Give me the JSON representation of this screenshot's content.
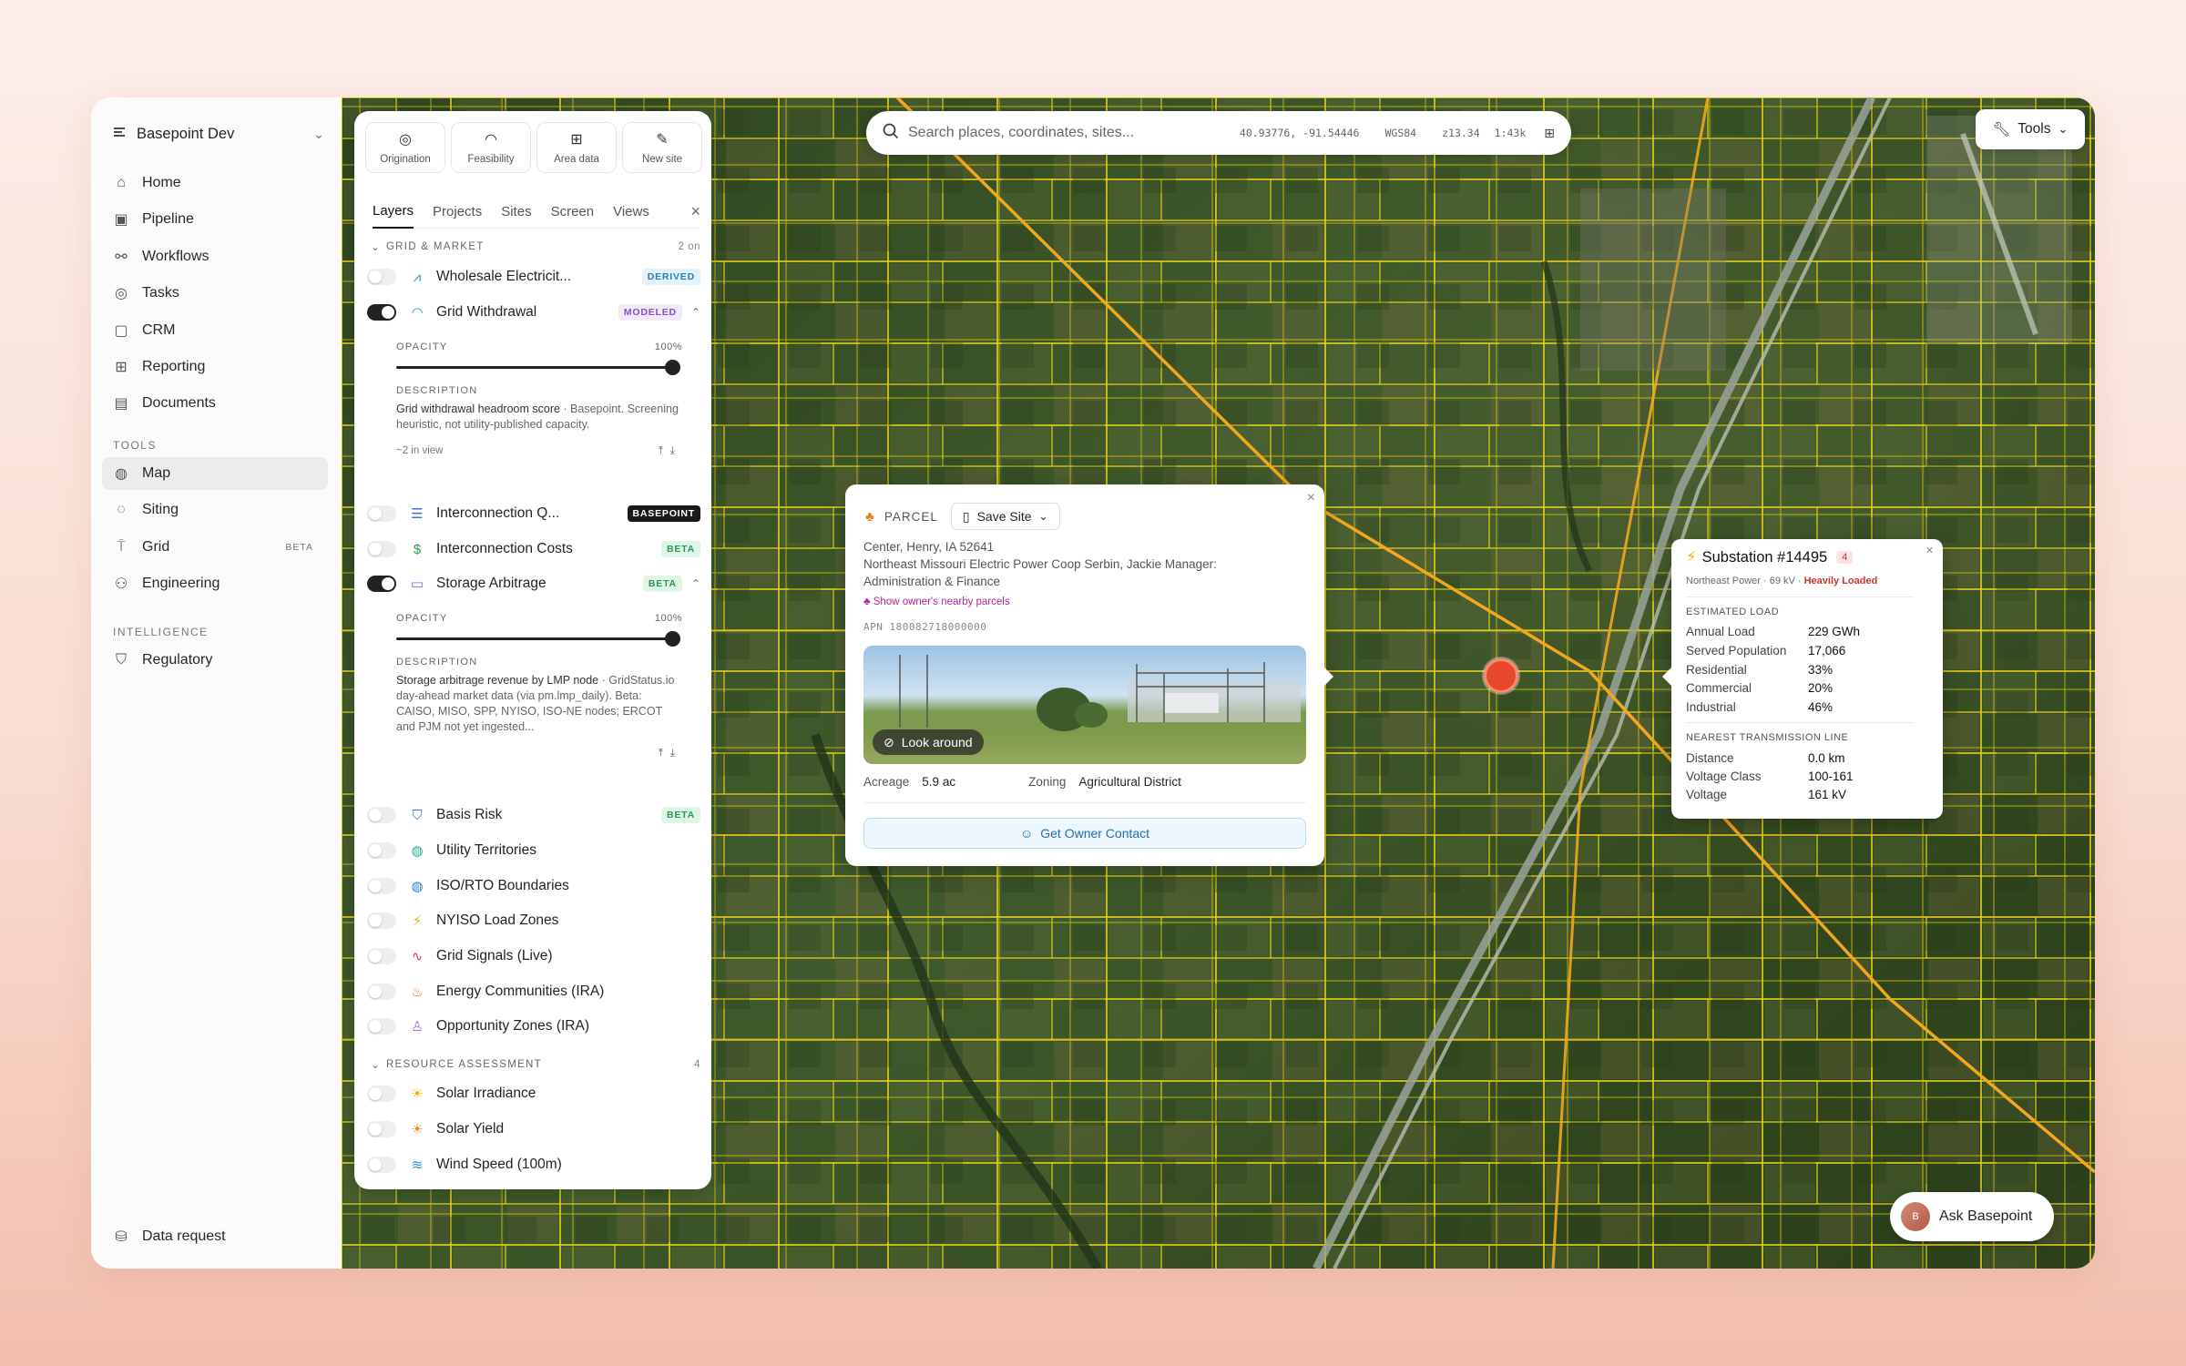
{
  "workspace": {
    "name": "Basepoint Dev"
  },
  "nav": {
    "main": [
      {
        "label": "Home",
        "icon": "home-icon"
      },
      {
        "label": "Pipeline",
        "icon": "briefcase-icon"
      },
      {
        "label": "Workflows",
        "icon": "workflow-icon"
      },
      {
        "label": "Tasks",
        "icon": "check-circle-icon"
      },
      {
        "label": "CRM",
        "icon": "contact-icon"
      },
      {
        "label": "Reporting",
        "icon": "grid-icon"
      },
      {
        "label": "Documents",
        "icon": "document-icon"
      }
    ],
    "tools_header": "TOOLS",
    "tools": [
      {
        "label": "Map",
        "icon": "globe-icon",
        "active": true
      },
      {
        "label": "Siting",
        "icon": "target-icon"
      },
      {
        "label": "Grid",
        "icon": "tower-icon",
        "badge": "BETA"
      },
      {
        "label": "Engineering",
        "icon": "engineer-icon"
      }
    ],
    "intelligence_header": "INTELLIGENCE",
    "intelligence": [
      {
        "label": "Regulatory",
        "icon": "shield-icon"
      }
    ],
    "bottom": {
      "label": "Data request",
      "icon": "database-icon"
    }
  },
  "panel": {
    "toolbar": [
      {
        "label": "Origination",
        "icon": "radar-icon"
      },
      {
        "label": "Feasibility",
        "icon": "gauge-icon"
      },
      {
        "label": "Area data",
        "icon": "table-icon"
      },
      {
        "label": "New site",
        "icon": "pencil-icon"
      }
    ],
    "tabs": [
      "Layers",
      "Projects",
      "Sites",
      "Screen",
      "Views"
    ],
    "grid_section": {
      "title": "GRID & MARKET",
      "count": "2 on"
    },
    "layers": [
      {
        "name": "Wholesale Electricit...",
        "tag": "DERIVED",
        "icon_color": "#2b8fd0",
        "icon": "pulse-icon"
      },
      {
        "name": "Grid Withdrawal",
        "tag": "MODELED",
        "icon_color": "#22a2a8",
        "icon": "gauge-icon",
        "on": true
      },
      {
        "name": "Interconnection Q...",
        "tag": "BASEPOINT",
        "icon_color": "#3d6fd6",
        "icon": "list-icon"
      },
      {
        "name": "Interconnection Costs",
        "tag": "BETA",
        "icon_color": "#2a9a55",
        "icon": "dollar-icon"
      },
      {
        "name": "Storage Arbitrage",
        "tag": "BETA",
        "icon_color": "#7c68d8",
        "icon": "battery-icon",
        "on": true
      },
      {
        "name": "Basis Risk",
        "tag": "BETA",
        "icon_color": "#3a78d0",
        "icon": "shield-icon"
      },
      {
        "name": "Utility Territories",
        "icon_color": "#1ea88e",
        "icon": "globe-icon"
      },
      {
        "name": "ISO/RTO Boundaries",
        "icon_color": "#2b7fd0",
        "icon": "globe-icon"
      },
      {
        "name": "NYISO Load Zones",
        "icon_color": "#f0b400",
        "icon": "bolt-icon"
      },
      {
        "name": "Grid Signals (Live)",
        "icon_color": "#e0345c",
        "icon": "signal-icon"
      },
      {
        "name": "Energy Communities (IRA)",
        "icon_color": "#e87b1e",
        "icon": "flame-icon"
      },
      {
        "name": "Opportunity Zones (IRA)",
        "icon_color": "#9b6dd8",
        "icon": "award-icon"
      }
    ],
    "grid_withdrawal_detail": {
      "opacity_label": "OPACITY",
      "opacity": "100%",
      "opacity_value": 1.0,
      "desc_label": "DESCRIPTION",
      "desc": "Grid withdrawal headroom score",
      "desc_src": " · Basepoint. Screening heuristic, not utility-published capacity.",
      "footer": "~2 in view"
    },
    "storage_detail": {
      "opacity_label": "OPACITY",
      "opacity": "100%",
      "opacity_value": 1.0,
      "desc_label": "DESCRIPTION",
      "desc": "Storage arbitrage revenue by LMP node",
      "desc_src": " · GridStatus.io day-ahead market data (via pm.lmp_daily). Beta: CAISO, MISO, SPP, NYISO, ISO-NE nodes; ERCOT and PJM not yet ingested..."
    },
    "resource_section": {
      "title": "RESOURCE ASSESSMENT",
      "count": "4"
    },
    "resource_layers": [
      {
        "name": "Solar Irradiance",
        "icon_color": "#f0b400",
        "icon": "sun-icon"
      },
      {
        "name": "Solar Yield",
        "icon_color": "#f08a1e",
        "icon": "sun-icon"
      },
      {
        "name": "Wind Speed (100m)",
        "icon_color": "#2b8fd0",
        "icon": "wind-icon"
      }
    ]
  },
  "search": {
    "placeholder": "Search places, coordinates, sites...",
    "coords": "40.93776, -91.54446",
    "datum": "WGS84",
    "zoom": "z13.34",
    "scale": "1:43k"
  },
  "tools_button": {
    "label": "Tools"
  },
  "parcel": {
    "type": "PARCEL",
    "save_label": "Save Site",
    "address": "Center, Henry, IA 52641",
    "owner": "Northeast Missouri Electric Power Coop Serbin, Jackie Manager: Administration & Finance",
    "owner_link": "Show owner's nearby parcels",
    "apn": "APN 180082718000000",
    "look_around": "Look around",
    "acreage_label": "Acreage",
    "acreage": "5.9 ac",
    "zoning_label": "Zoning",
    "zoning": "Agricultural District",
    "contact_label": "Get Owner Contact"
  },
  "substation": {
    "title": "Substation #14495",
    "count": "4",
    "operator": "Northeast Power · 69 kV · ",
    "status": "Heavily Loaded",
    "load_header": "ESTIMATED LOAD",
    "load_rows": [
      {
        "k": "Annual Load",
        "v": "229 GWh"
      },
      {
        "k": "Served Population",
        "v": "17,066"
      },
      {
        "k": "Residential",
        "v": "33%"
      },
      {
        "k": "Commercial",
        "v": "20%"
      },
      {
        "k": "Industrial",
        "v": "46%"
      }
    ],
    "tx_header": "NEAREST TRANSMISSION LINE",
    "tx_rows": [
      {
        "k": "Distance",
        "v": "0.0 km"
      },
      {
        "k": "Voltage Class",
        "v": "100-161"
      },
      {
        "k": "Voltage",
        "v": "161 kV"
      }
    ]
  },
  "ask": {
    "label": "Ask Basepoint",
    "avatar": "B"
  },
  "colors": {
    "accent": "#1f2328",
    "parcel_lines": "#e8d21a",
    "transmission": "#f2a81d",
    "pin": "#e8482b"
  }
}
